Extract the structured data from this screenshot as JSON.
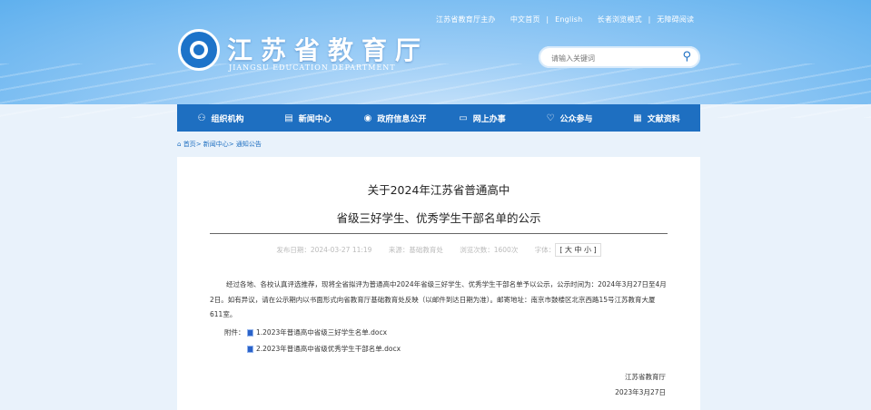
{
  "header": {
    "top_links": [
      "江苏省教育厅主办",
      "中文首页",
      "English",
      "长者浏览模式",
      "无障碍阅读"
    ],
    "site_title": "江苏省教育厅",
    "site_subtitle": "JIANGSU EDUCATION DEPARTMENT",
    "search_placeholder": "请输入关键词"
  },
  "nav": {
    "items": [
      {
        "label": "组织机构",
        "icon": "org-chart-icon",
        "glyph": "⚇"
      },
      {
        "label": "新闻中心",
        "icon": "news-icon",
        "glyph": "▤"
      },
      {
        "label": "政府信息公开",
        "icon": "info-icon",
        "glyph": "◉"
      },
      {
        "label": "网上办事",
        "icon": "monitor-icon",
        "glyph": "▭"
      },
      {
        "label": "公众参与",
        "icon": "heart-icon",
        "glyph": "♡"
      },
      {
        "label": "文献资料",
        "icon": "document-icon",
        "glyph": "▦"
      }
    ]
  },
  "breadcrumb": {
    "home": "首页",
    "news": "新闻中心",
    "notices": "通知公告",
    "separator": ">"
  },
  "article": {
    "title_line1": "关于2024年江苏省普通高中",
    "title_line2": "省级三好学生、优秀学生干部名单的公示",
    "meta": {
      "published": "发布日期：2024-03-27 11:19",
      "source": "来源：基础教育处",
      "views": "浏览次数：1600次",
      "font_label": "字体：",
      "font_sizes": "[ 大 中 小 ]"
    },
    "body": "经过各地、各校认真评选推荐，现将全省拟评为普通高中2024年省级三好学生、优秀学生干部名单予以公示，公示时间为：2024年3月27日至4月2日。如有异议，请在公示期内以书面形式向省教育厅基础教育处反映（以邮件到达日期为准）。邮寄地址：南京市鼓楼区北京西路15号江苏教育大厦611室。",
    "attachments_label": "附件：",
    "attachments": [
      "1.2023年普通高中省级三好学生名单.docx",
      "2.2023年普通高中省级优秀学生干部名单.docx"
    ],
    "signature": "江苏省教育厅",
    "date": "2023年3月27日"
  }
}
